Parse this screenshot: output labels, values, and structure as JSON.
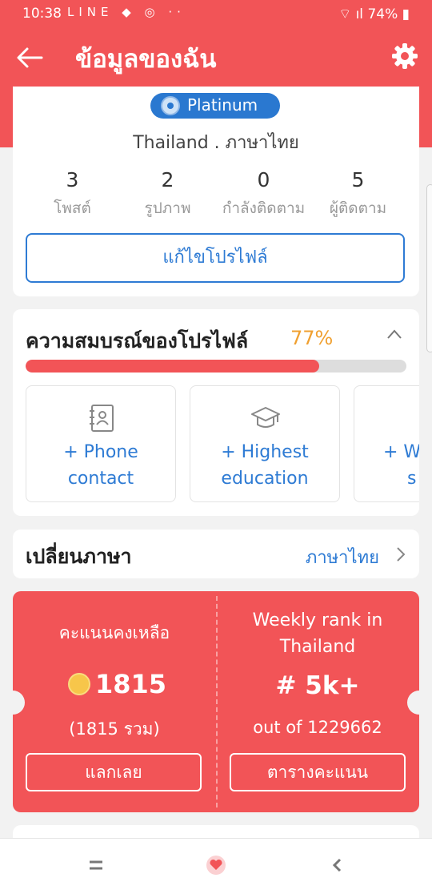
{
  "status_bar": {
    "time": "10:38",
    "icons": "LINE ◆ ◎ ··",
    "battery": "74%"
  },
  "header": {
    "title": "ข้อมูลของฉัน"
  },
  "profile": {
    "badge": "Platinum",
    "location": "Thailand . ภาษาไทย",
    "stats": [
      {
        "value": "3",
        "label": "โพสต์"
      },
      {
        "value": "2",
        "label": "รูปภาพ"
      },
      {
        "value": "0",
        "label": "กำลังติดตาม"
      },
      {
        "value": "5",
        "label": "ผู้ติดตาม"
      }
    ],
    "edit_label": "แก้ไขโปรไฟล์"
  },
  "completeness": {
    "title": "ความสมบรณ์ของโปรไฟล์",
    "percent_text": "77%",
    "percent": 77,
    "tiles": [
      {
        "line1": "+ Phone",
        "line2": "contact",
        "icon": "contact-book-icon"
      },
      {
        "line1": "+ Highest",
        "line2": "education",
        "icon": "graduation-cap-icon"
      },
      {
        "line1": "+ W",
        "line2": "s",
        "icon": "partial-tile"
      }
    ]
  },
  "language": {
    "title": "เปลี่ยนภาษา",
    "value": "ภาษาไทย"
  },
  "points": {
    "remaining_label": "คะแนนคงเหลือ",
    "points": "1815",
    "total": "(1815 รวม)",
    "redeem_label": "แลกเลย",
    "rank_label_line1": "Weekly rank in",
    "rank_label_line2": "Thailand",
    "rank": "# 5k+",
    "out_of": "out of 1229662",
    "leaderboard_label": "ตารางคะแนน"
  },
  "colors": {
    "brand": "#f25457",
    "link": "#2e7bd4",
    "percent": "#f0a030"
  }
}
